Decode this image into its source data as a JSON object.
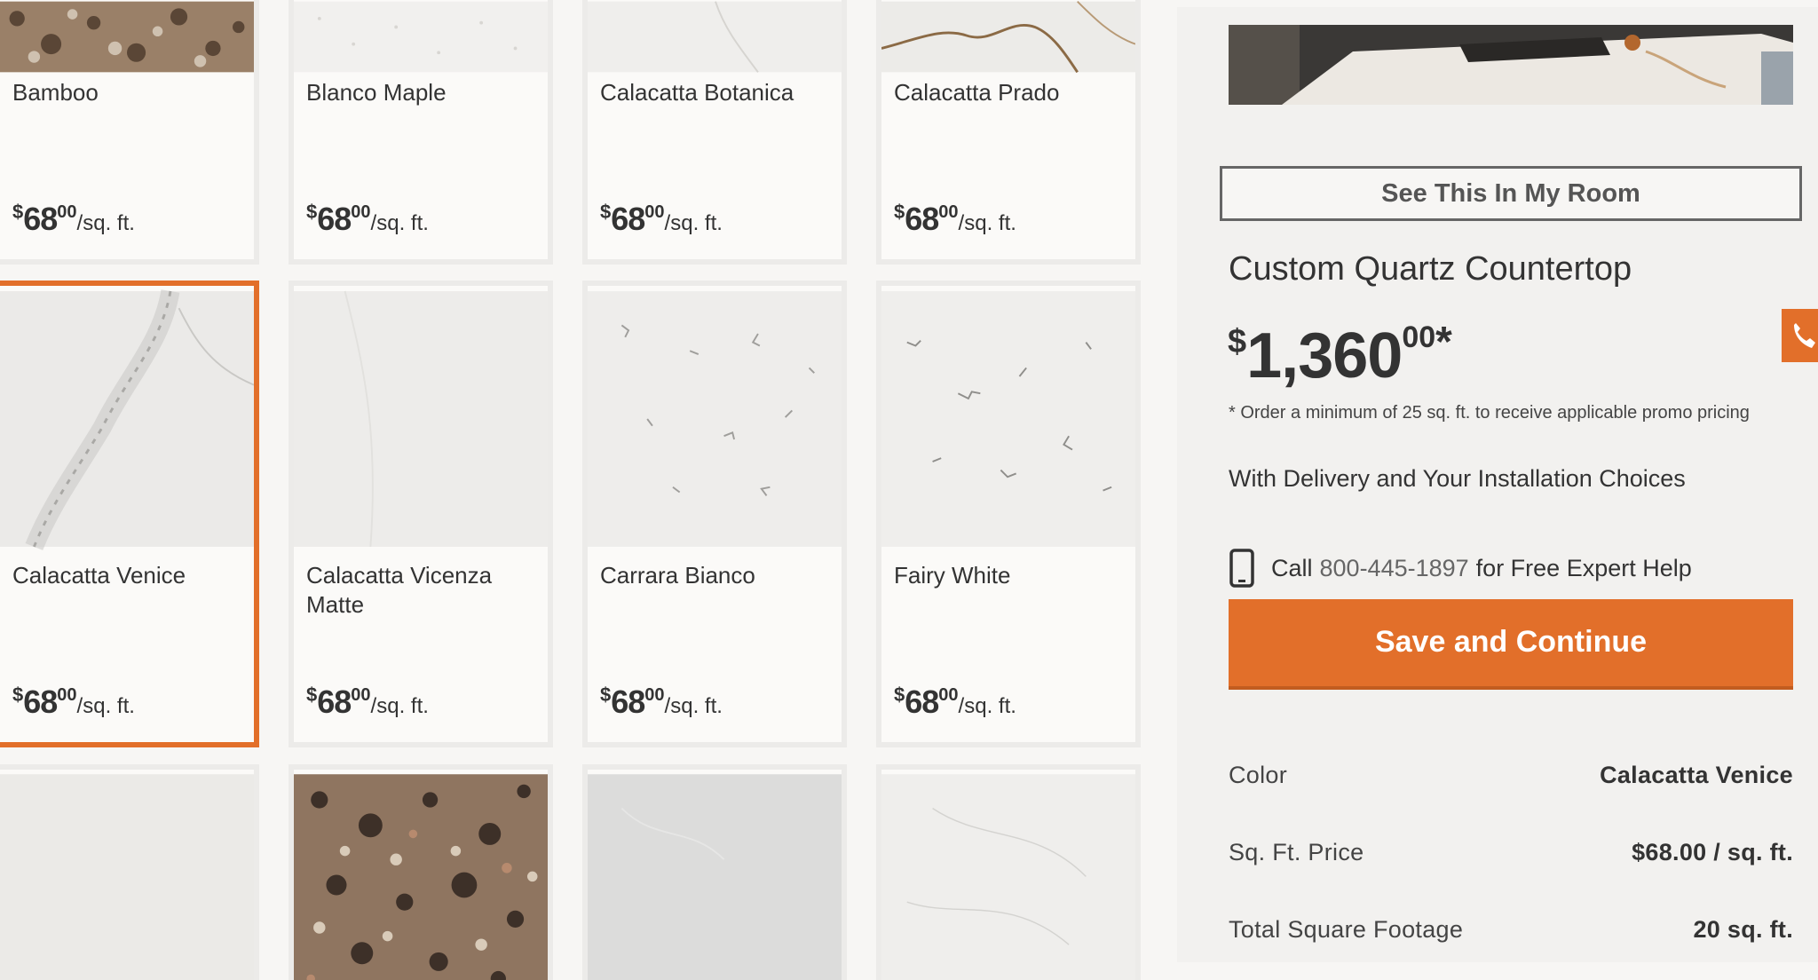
{
  "grid": {
    "cards": [
      {
        "name": "Bamboo",
        "price": {
          "currency": "$",
          "whole": "68",
          "cents": "00",
          "unit": "/sq. ft."
        },
        "swatch": "granite-brown"
      },
      {
        "name": "Blanco Maple",
        "price": {
          "currency": "$",
          "whole": "68",
          "cents": "00",
          "unit": "/sq. ft."
        },
        "swatch": "white-speckle"
      },
      {
        "name": "Calacatta Botanica",
        "price": {
          "currency": "$",
          "whole": "68",
          "cents": "00",
          "unit": "/sq. ft."
        },
        "swatch": "white-vein"
      },
      {
        "name": "Calacatta Prado",
        "price": {
          "currency": "$",
          "whole": "68",
          "cents": "00",
          "unit": "/sq. ft."
        },
        "swatch": "white-gold-vein"
      },
      {
        "name": "Calacatta Venice",
        "price": {
          "currency": "$",
          "whole": "68",
          "cents": "00",
          "unit": "/sq. ft."
        },
        "swatch": "white-gray-vein",
        "selected": true
      },
      {
        "name": "Calacatta Vicenza Matte",
        "price": {
          "currency": "$",
          "whole": "68",
          "cents": "00",
          "unit": "/sq. ft."
        },
        "swatch": "white-plain"
      },
      {
        "name": "Carrara Bianco",
        "price": {
          "currency": "$",
          "whole": "68",
          "cents": "00",
          "unit": "/sq. ft."
        },
        "swatch": "white-fleck"
      },
      {
        "name": "Fairy White",
        "price": {
          "currency": "$",
          "whole": "68",
          "cents": "00",
          "unit": "/sq. ft."
        },
        "swatch": "white-fleck"
      },
      {
        "name": "",
        "swatch": "white-plain"
      },
      {
        "name": "",
        "swatch": "granite-brown"
      },
      {
        "name": "",
        "swatch": "gray-plain"
      },
      {
        "name": "",
        "swatch": "white-fleck"
      }
    ]
  },
  "panel": {
    "see_in_room": "See This In My Room",
    "product_title": "Custom Quartz Countertop",
    "price": {
      "currency": "$",
      "whole": "1,360",
      "cents": "00",
      "asterisk": "*"
    },
    "promo_note": "* Order a minimum of 25 sq. ft. to receive applicable promo pricing",
    "delivery_text": "With Delivery and Your Installation Choices",
    "call": {
      "prefix": "Call",
      "phone": "800-445-1897",
      "suffix": "for Free Expert Help"
    },
    "save_button": "Save and Continue",
    "specs": [
      {
        "label": "Color",
        "value": "Calacatta Venice"
      },
      {
        "label": "Sq. Ft. Price",
        "value": "$68.00 / sq. ft."
      },
      {
        "label": "Total Square Footage",
        "value": "20 sq. ft."
      }
    ]
  },
  "colors": {
    "accent": "#e26f2a",
    "card_border": "#ecebe9",
    "panel_bg": "#f2f1ef"
  },
  "icons": {
    "call_tab": "phone-icon",
    "call_row": "mobile-phone-icon"
  }
}
